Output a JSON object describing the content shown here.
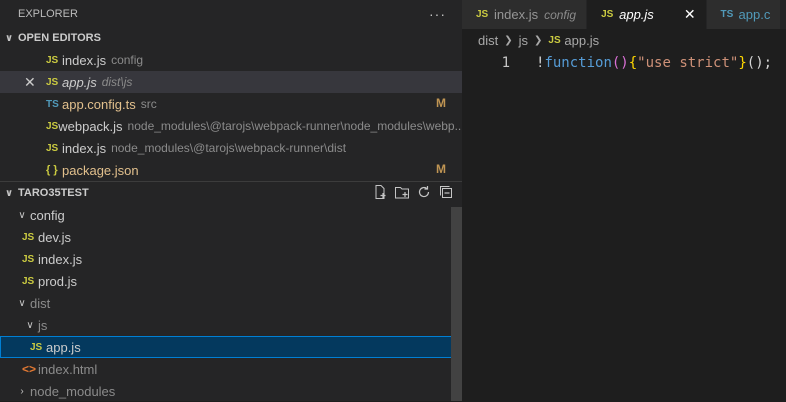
{
  "explorer": {
    "title": "EXPLORER",
    "more_glyph": "···",
    "open_editors": {
      "header": "OPEN EDITORS",
      "items": [
        {
          "icon": "JS",
          "name": "index.js",
          "desc": "config",
          "badge": ""
        },
        {
          "icon": "JS",
          "name": "app.js",
          "desc": "dist\\js",
          "badge": ""
        },
        {
          "icon": "TS",
          "name": "app.config.ts",
          "desc": "src",
          "badge": "M"
        },
        {
          "icon": "JS",
          "name": "webpack.js",
          "desc": "node_modules\\@tarojs\\webpack-runner\\node_modules\\webp...",
          "badge": ""
        },
        {
          "icon": "JS",
          "name": "index.js",
          "desc": "node_modules\\@tarojs\\webpack-runner\\dist",
          "badge": ""
        },
        {
          "icon": "{ }",
          "name": "package.json",
          "desc": "",
          "badge": "M"
        }
      ]
    },
    "project": {
      "header": "TARO35TEST",
      "tree": [
        {
          "chev": "∨",
          "icon": "",
          "name": "config"
        },
        {
          "chev": "",
          "icon": "JS",
          "name": "dev.js"
        },
        {
          "chev": "",
          "icon": "JS",
          "name": "index.js"
        },
        {
          "chev": "",
          "icon": "JS",
          "name": "prod.js"
        },
        {
          "chev": "∨",
          "icon": "",
          "name": "dist"
        },
        {
          "chev": "∨",
          "icon": "",
          "name": "js"
        },
        {
          "chev": "",
          "icon": "JS",
          "name": "app.js"
        },
        {
          "chev": "",
          "icon": "<>",
          "name": "index.html"
        },
        {
          "chev": "›",
          "icon": "",
          "name": "node_modules"
        }
      ]
    }
  },
  "editor": {
    "tabs": [
      {
        "icon": "JS",
        "name": "index.js",
        "desc": "config"
      },
      {
        "icon": "JS",
        "name": "app.js",
        "close": "✕"
      },
      {
        "icon": "TS",
        "name": "app.c"
      }
    ],
    "breadcrumb": {
      "seg1": "dist",
      "seg2": "js",
      "icon": "JS",
      "file": "app.js"
    },
    "code": {
      "line_number": "1",
      "tok1": "!",
      "tok2": "function",
      "tok3": "()",
      "tok4": "{",
      "tok5": "\"use strict\"",
      "tok6": "}",
      "tok7": "();"
    }
  }
}
